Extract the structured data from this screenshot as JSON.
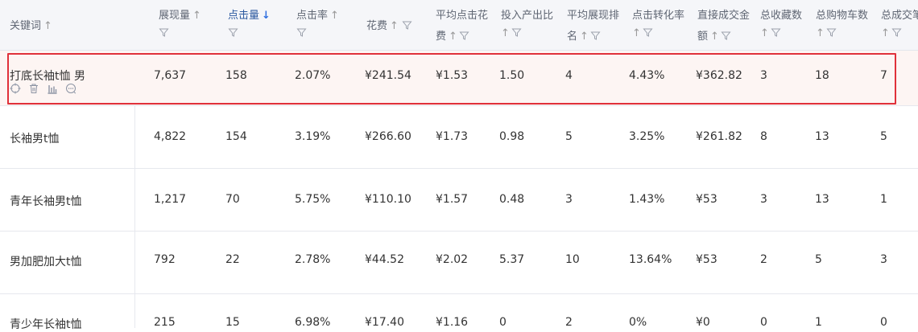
{
  "header": {
    "keyword": "关键词",
    "impressions": "展现量",
    "clicks": "点击量",
    "ctr": "点击率",
    "cost": "花费",
    "avg_cpc_1": "平均点击花",
    "avg_cpc_2": "费",
    "roi_1": "投入产出比",
    "avg_rank_1": "平均展现排",
    "avg_rank_2": "名",
    "cvr_1": "点击转化率",
    "direct_gmv_1": "直接成交金",
    "direct_gmv_2": "额",
    "fav": "总收藏数",
    "cart": "总购物车数",
    "orders": "总成交笔",
    "sort_up": "↑",
    "sort_down": "↓"
  },
  "rows": [
    {
      "keyword": "打底长袖t恤 男",
      "impressions": "7,637",
      "clicks": "158",
      "ctr": "2.07%",
      "cost": "¥241.54",
      "avg_cpc": "¥1.53",
      "roi": "1.50",
      "avg_rank": "4",
      "cvr": "4.43%",
      "direct_gmv": "¥362.82",
      "fav": "3",
      "cart": "18",
      "orders": "7"
    },
    {
      "keyword": "长袖男t恤",
      "impressions": "4,822",
      "clicks": "154",
      "ctr": "3.19%",
      "cost": "¥266.60",
      "avg_cpc": "¥1.73",
      "roi": "0.98",
      "avg_rank": "5",
      "cvr": "3.25%",
      "direct_gmv": "¥261.82",
      "fav": "8",
      "cart": "13",
      "orders": "5"
    },
    {
      "keyword": "青年长袖男t恤",
      "impressions": "1,217",
      "clicks": "70",
      "ctr": "5.75%",
      "cost": "¥110.10",
      "avg_cpc": "¥1.57",
      "roi": "0.48",
      "avg_rank": "3",
      "cvr": "1.43%",
      "direct_gmv": "¥53",
      "fav": "3",
      "cart": "13",
      "orders": "1"
    },
    {
      "keyword": "男加肥加大t恤",
      "impressions": "792",
      "clicks": "22",
      "ctr": "2.78%",
      "cost": "¥44.52",
      "avg_cpc": "¥2.02",
      "roi": "5.37",
      "avg_rank": "10",
      "cvr": "13.64%",
      "direct_gmv": "¥53",
      "fav": "2",
      "cart": "5",
      "orders": "3"
    },
    {
      "keyword": "青少年长袖t恤",
      "impressions": "215",
      "clicks": "15",
      "ctr": "6.98%",
      "cost": "¥17.40",
      "avg_cpc": "¥1.16",
      "roi": "0",
      "avg_rank": "2",
      "cvr": "0%",
      "direct_gmv": "¥0",
      "fav": "0",
      "cart": "1",
      "orders": "0"
    }
  ],
  "colors": {
    "highlight_border": "#e0313a",
    "sort_active": "#2f6fe0",
    "header_bg": "#f5f6f9",
    "selected_row_bg": "#fdf5f3"
  },
  "icons": [
    "target-icon",
    "delete-icon",
    "bar-chart-icon",
    "more-icon",
    "filter-icon"
  ]
}
